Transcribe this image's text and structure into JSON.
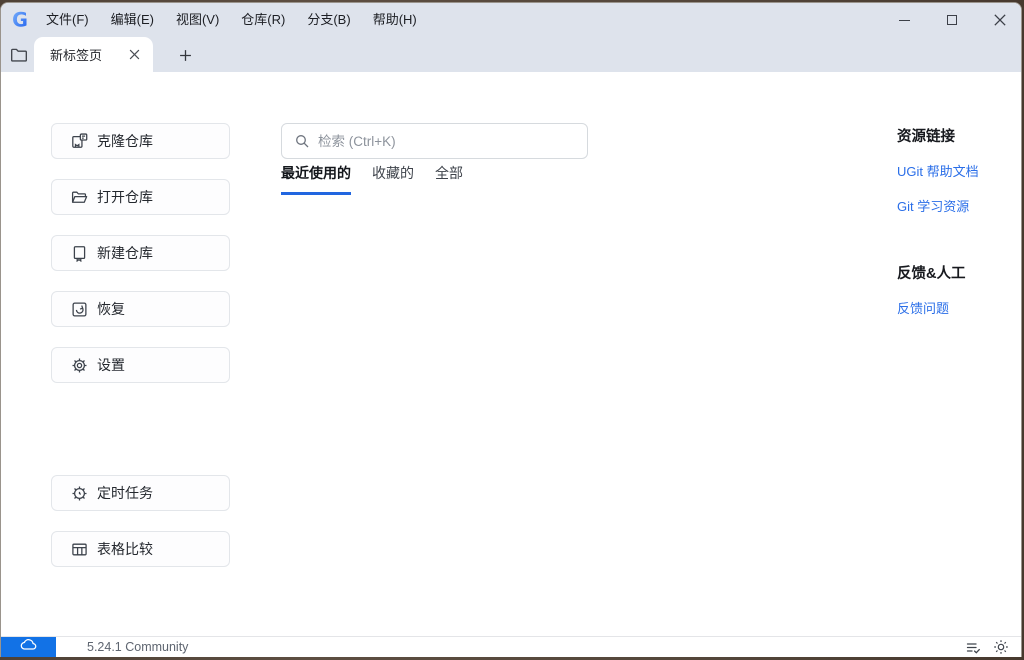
{
  "titlebar": {
    "logo_text": "G",
    "menu_items": [
      "文件(F)",
      "编辑(E)",
      "视图(V)",
      "仓库(R)",
      "分支(B)",
      "帮助(H)"
    ]
  },
  "tabbar": {
    "active_tab": "新标签页"
  },
  "sidebar": {
    "primary": [
      {
        "label": "克隆仓库",
        "icon": "repo-clone-icon"
      },
      {
        "label": "打开仓库",
        "icon": "folder-open-icon"
      },
      {
        "label": "新建仓库",
        "icon": "repo-new-icon"
      },
      {
        "label": "恢复",
        "icon": "restore-icon"
      },
      {
        "label": "设置",
        "icon": "gear-icon"
      }
    ],
    "secondary": [
      {
        "label": "定时任务",
        "icon": "scheduled-task-icon"
      },
      {
        "label": "表格比较",
        "icon": "table-compare-icon"
      }
    ]
  },
  "main": {
    "search_placeholder": "检索 (Ctrl+K)",
    "filter_tabs": [
      {
        "label": "最近使用的",
        "active": true
      },
      {
        "label": "收藏的",
        "active": false
      },
      {
        "label": "全部",
        "active": false
      }
    ]
  },
  "right_panel": {
    "sections": [
      {
        "title": "资源链接",
        "links": [
          "UGit 帮助文档",
          "Git 学习资源"
        ]
      },
      {
        "title": "反馈&人工",
        "links": [
          "反馈问题"
        ]
      }
    ]
  },
  "statusbar": {
    "version": "5.24.1 Community"
  },
  "icons": {
    "titlebar": [
      "ugit-logo",
      "minimize-icon",
      "maximize-icon",
      "close-icon"
    ],
    "tabbar": [
      "folder-icon",
      "close-icon",
      "plus-icon"
    ],
    "search": "magnifier-icon",
    "statusbar": [
      "cloud-icon",
      "task-list-check-icon",
      "sun-theme-icon"
    ]
  },
  "colors": {
    "titlebar_bg": "#dee3ec",
    "accent_blue": "#1272e6",
    "link_blue": "#2a6ee8",
    "tab_underline": "#2166e0"
  }
}
